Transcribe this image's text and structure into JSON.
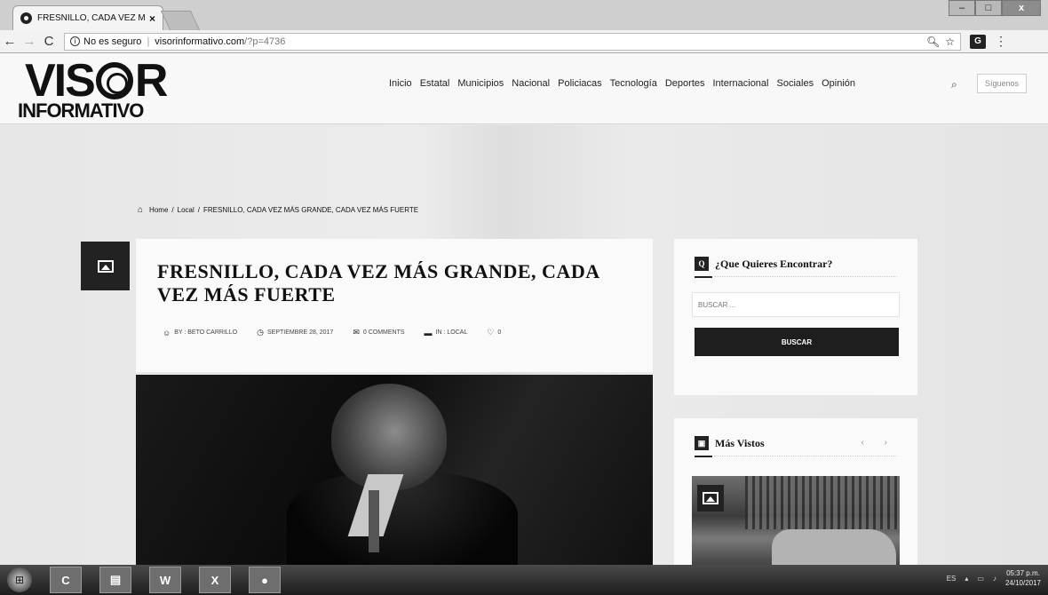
{
  "browser": {
    "tab_title": "FRESNILLO, CADA VEZ M",
    "tab_close": "×",
    "security_label": "No es seguro",
    "url_host": "visorinformativo.com",
    "url_path": "/?p=4736",
    "window_controls": {
      "minimize": "–",
      "maximize": "□",
      "close": "x"
    },
    "ext_badge": "G"
  },
  "site": {
    "logo_top_left": "VIS",
    "logo_top_right": "R",
    "logo_bottom": "INFORMATIVO",
    "nav": [
      "Inicio",
      "Estatal",
      "Municipios",
      "Nacional",
      "Policiacas",
      "Tecnología",
      "Deportes",
      "Internacional",
      "Sociales",
      "Opinión"
    ],
    "follow_label": "Síguenos"
  },
  "breadcrumb": {
    "home": "Home",
    "sep1": "/",
    "category": "Local",
    "sep2": "/",
    "current": "FRESNILLO, CADA VEZ MÁS GRANDE, CADA VEZ MÁS FUERTE"
  },
  "article": {
    "title": "FRESNILLO, CADA VEZ MÁS GRANDE, CADA VEZ MÁS FUERTE",
    "author": "BY : BETO CARRILLO",
    "date": "SEPTIEMBRE 28, 2017",
    "comments": "0 COMMENTS",
    "category": "IN : LOCAL",
    "likes": "0"
  },
  "sidebar": {
    "search_title": "¿Que Quieres Encontrar?",
    "search_placeholder": "BUSCAR ...",
    "search_button": "BUSCAR",
    "popular_title": "Más Vistos",
    "popular_arrows": "‹ ›"
  },
  "taskbar": {
    "apps": [
      "C",
      "▤",
      "W",
      "X",
      "●"
    ],
    "lang": "ES",
    "time": "05:37 p.m.",
    "date": "24/10/2017"
  },
  "colors": {
    "accent": "#1e1e1e",
    "page_bg": "#e9e9e9",
    "card_bg": "#fafafa"
  },
  "icons": [
    "search-icon",
    "star-icon",
    "home-icon",
    "image-icon",
    "user-icon",
    "clock-icon",
    "comment-icon",
    "folder-icon",
    "heart-icon"
  ]
}
